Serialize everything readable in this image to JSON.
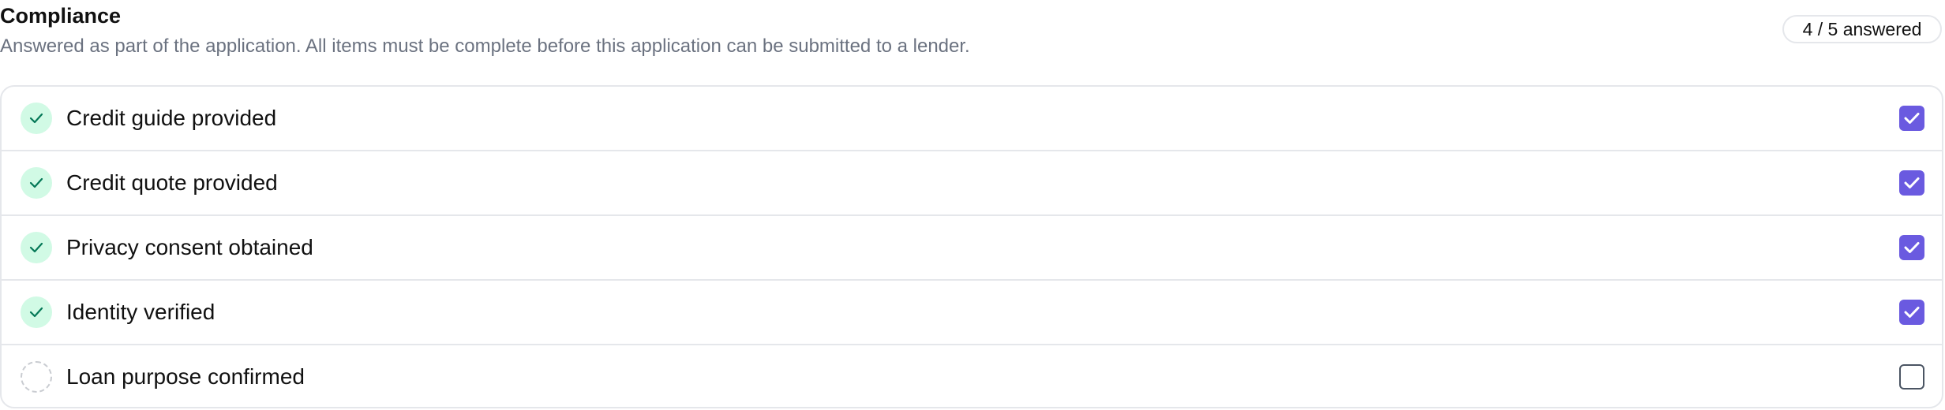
{
  "header": {
    "title": "Compliance",
    "subtitle": "Answered as part of the application. All items must be complete before this application can be submitted to a lender.",
    "answered_badge": "4 / 5 answered"
  },
  "items": [
    {
      "label": "Credit guide provided",
      "status": "complete",
      "checked": true,
      "status_icon": "check-icon"
    },
    {
      "label": "Credit quote provided",
      "status": "complete",
      "checked": true,
      "status_icon": "check-icon"
    },
    {
      "label": "Privacy consent obtained",
      "status": "complete",
      "checked": true,
      "status_icon": "check-icon"
    },
    {
      "label": "Identity verified",
      "status": "complete",
      "checked": true,
      "status_icon": "check-icon"
    },
    {
      "label": "Loan purpose confirmed",
      "status": "pending",
      "checked": false,
      "status_icon": "dashed-circle-icon"
    }
  ],
  "colors": {
    "complete_bg": "#d1fae5",
    "complete_check": "#047857",
    "checkbox_accent": "#6a5ae0",
    "border": "#e5e7eb",
    "subtitle_text": "#6b7280"
  }
}
